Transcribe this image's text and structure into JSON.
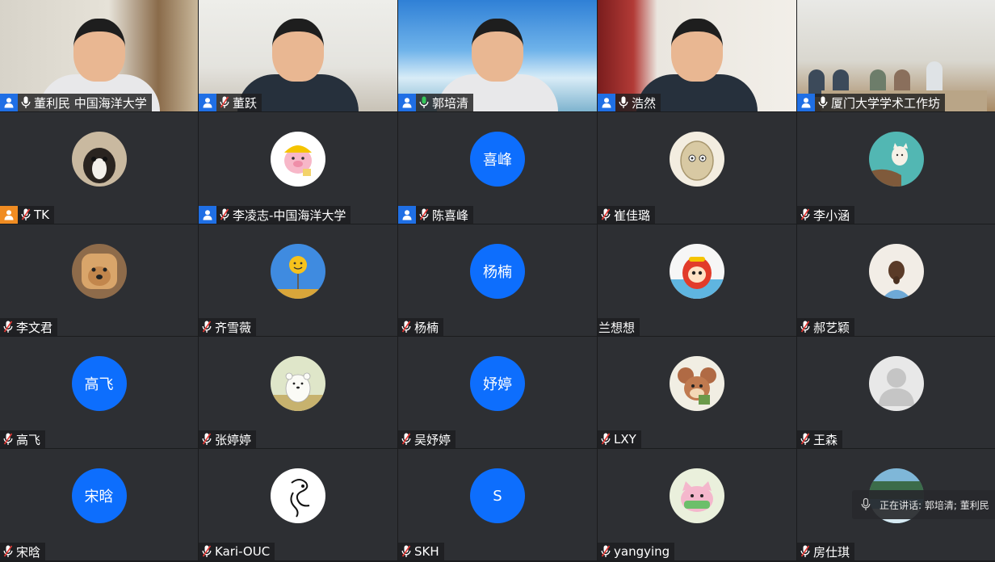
{
  "participants": [
    {
      "name": "董利民 中国海洋大学",
      "type": "video",
      "scene": "s0",
      "badge": "blue",
      "mic": "on",
      "body": "light"
    },
    {
      "name": "董跃",
      "type": "video",
      "scene": "s1",
      "badge": "blue",
      "mic": "muted",
      "body": "dark"
    },
    {
      "name": "郭培清",
      "type": "video",
      "scene": "s2",
      "badge": "blue",
      "mic": "speaking",
      "body": "light"
    },
    {
      "name": "浩然",
      "type": "video",
      "scene": "s3",
      "badge": "blue",
      "mic": "on",
      "body": "dark"
    },
    {
      "name": "厦门大学学术工作坊",
      "type": "video",
      "scene": "s4",
      "badge": "blue",
      "mic": "on",
      "body": "room"
    },
    {
      "name": "TK",
      "type": "image",
      "icon": "dog-photo-avatar",
      "badge": "orange",
      "mic": "muted"
    },
    {
      "name": "李凌志-中国海洋大学",
      "type": "image",
      "icon": "cartoon-pig-avatar",
      "badge": "blue",
      "mic": "muted"
    },
    {
      "name": "陈喜峰",
      "type": "text",
      "avatar_text": "喜峰",
      "badge": "blue",
      "mic": "muted"
    },
    {
      "name": "崔佳璐",
      "type": "image",
      "icon": "cartoon-nut-avatar",
      "badge": "none",
      "mic": "muted"
    },
    {
      "name": "李小涵",
      "type": "image",
      "icon": "cartoon-cat-avatar",
      "badge": "none",
      "mic": "muted"
    },
    {
      "name": "李文君",
      "type": "image",
      "icon": "dog-bread-avatar",
      "badge": "none",
      "mic": "muted"
    },
    {
      "name": "齐雪薇",
      "type": "image",
      "icon": "smiley-balloon-avatar",
      "badge": "none",
      "mic": "muted"
    },
    {
      "name": "杨楠",
      "type": "text",
      "avatar_text": "杨楠",
      "badge": "none",
      "mic": "muted"
    },
    {
      "name": "兰想想",
      "type": "image",
      "icon": "cartoon-red-character-avatar",
      "badge": "none",
      "mic": "none"
    },
    {
      "name": "郝艺颖",
      "type": "image",
      "icon": "girl-back-avatar",
      "badge": "none",
      "mic": "muted"
    },
    {
      "name": "高飞",
      "type": "text",
      "avatar_text": "高飞",
      "badge": "none",
      "mic": "muted"
    },
    {
      "name": "张婷婷",
      "type": "image",
      "icon": "polar-bear-avatar",
      "badge": "none",
      "mic": "muted"
    },
    {
      "name": "吴妤婷",
      "type": "text",
      "avatar_text": "妤婷",
      "badge": "none",
      "mic": "muted"
    },
    {
      "name": "LXY",
      "type": "image",
      "icon": "cartoon-mouse-avatar",
      "badge": "none",
      "mic": "muted"
    },
    {
      "name": "王森",
      "type": "image",
      "icon": "default-user-avatar",
      "badge": "none",
      "mic": "muted"
    },
    {
      "name": "宋晗",
      "type": "text",
      "avatar_text": "宋晗",
      "badge": "none",
      "mic": "muted"
    },
    {
      "name": "Kari-OUC",
      "type": "image",
      "icon": "line-art-logo-avatar",
      "badge": "none",
      "mic": "muted"
    },
    {
      "name": "SKH",
      "type": "text",
      "avatar_text": "S",
      "badge": "none",
      "mic": "muted"
    },
    {
      "name": "yangying",
      "type": "image",
      "icon": "cartoon-pink-cat-avatar",
      "badge": "none",
      "mic": "muted"
    },
    {
      "name": "房仕琪",
      "type": "image",
      "icon": "landscape-avatar",
      "badge": "none",
      "mic": "muted"
    }
  ],
  "speaking_indicator": {
    "label": "正在讲话: 郭培清; 董利民",
    "icon": "mic-icon"
  },
  "colors": {
    "tile_bg": "#2d2f33",
    "avatar_blue": "#0d6efd",
    "host_badge_blue": "#1f6fe5",
    "badge_orange": "#f08c22",
    "mic_muted_red": "#e53935",
    "mic_speaking_green": "#34c759"
  }
}
